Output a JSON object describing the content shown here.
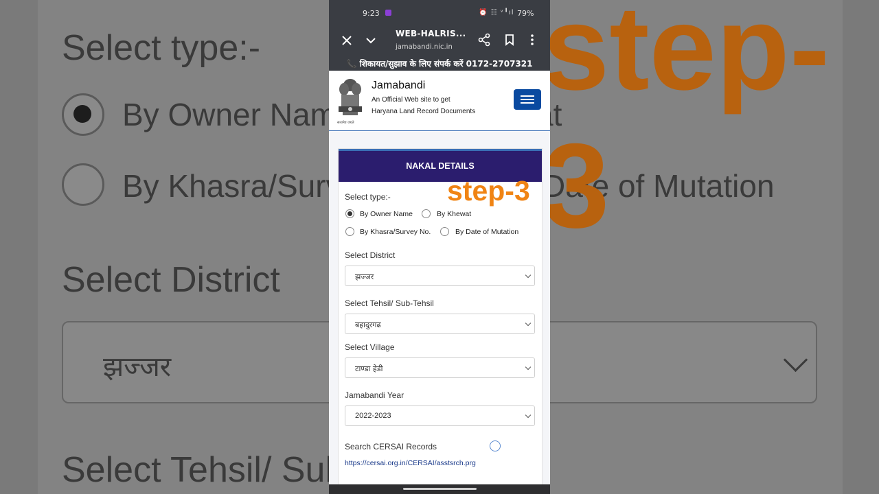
{
  "background": {
    "select_type_label": "Select type:-",
    "option_owner_partial": "By Owner Name",
    "option_khewat_partial": "at",
    "option_khasra_partial": "By Khasra/Surve",
    "option_mutation_partial": "Date of Mutation",
    "district_label": "Select District",
    "district_value": "झज्जर",
    "tehsil_label_partial": "Select Tehsil/ Sub",
    "step_partial": "step-3"
  },
  "status_bar": {
    "time": "9:23",
    "icons": "⏰ ☷ ᵛ╹ıl",
    "battery": "79%"
  },
  "browser": {
    "title": "WEB-HALRIS...",
    "url": "jamabandi.nic.in"
  },
  "contact_bar": {
    "text": "शिकायत/सुझाव के लिए संपर्क करें 0172-2707321"
  },
  "header": {
    "title": "Jamabandi",
    "subtitle_line1": "An Official Web site to get",
    "subtitle_line2": "Haryana Land Record Documents",
    "emblem_motto": "सत्यमेव जयते"
  },
  "form": {
    "heading": "NAKAL DETAILS",
    "select_type_label": "Select type:-",
    "options": [
      {
        "label": "By Owner Name",
        "selected": true
      },
      {
        "label": "By Khewat",
        "selected": false
      },
      {
        "label": "By Khasra/Survey No.",
        "selected": false
      },
      {
        "label": "By Date of Mutation",
        "selected": false
      }
    ],
    "district_label": "Select District",
    "district_value": "झज्जर",
    "tehsil_label": "Select Tehsil/ Sub-Tehsil",
    "tehsil_value": "बहादुरगढ",
    "village_label": "Select Village",
    "village_value": "टाण्डा हेडी",
    "year_label": "Jamabandi Year",
    "year_value": "2022-2023",
    "cersai_label": "Search CERSAI Records",
    "cersai_link": "https://cersai.org.in/CERSAI/asstsrch.prg"
  },
  "overlay": {
    "step_label": "step-3"
  },
  "colors": {
    "form_header_bg": "#2b1d6e",
    "menu_button_bg": "#0a4aa0",
    "step_label": "#f08414",
    "browser_bar_bg": "#3a3d43"
  }
}
